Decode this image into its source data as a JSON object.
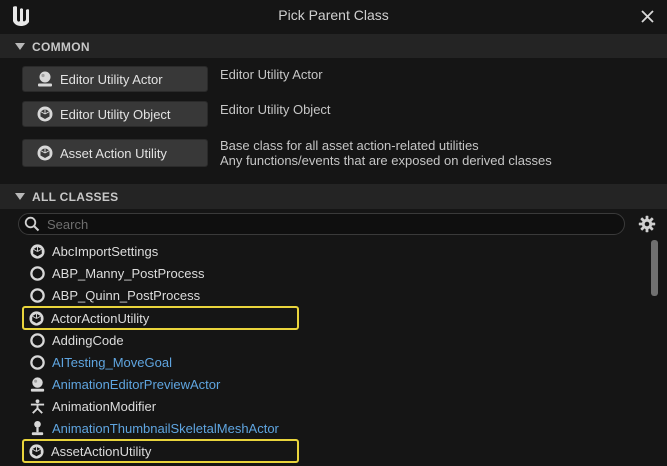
{
  "window": {
    "title": "Pick Parent Class"
  },
  "common": {
    "header": "COMMON",
    "buttons": [
      {
        "label": "Editor Utility Actor",
        "icon": "actor-icon",
        "desc1": "Editor Utility Actor",
        "desc2": ""
      },
      {
        "label": "Editor Utility Object",
        "icon": "object-icon",
        "desc1": "Editor Utility Object",
        "desc2": ""
      },
      {
        "label": "Asset Action Utility",
        "icon": "object-icon",
        "desc1": "Base class for all asset action-related utilities",
        "desc2": "Any functions/events that are exposed on derived classes"
      }
    ]
  },
  "all_classes": {
    "header": "ALL CLASSES",
    "search_placeholder": "Search",
    "items": [
      {
        "label": "AbcImportSettings",
        "icon": "object-icon",
        "style": "normal",
        "highlighted": false
      },
      {
        "label": "ABP_Manny_PostProcess",
        "icon": "circle-icon",
        "style": "normal",
        "highlighted": false
      },
      {
        "label": "ABP_Quinn_PostProcess",
        "icon": "circle-icon",
        "style": "normal",
        "highlighted": false
      },
      {
        "label": "ActorActionUtility",
        "icon": "object-icon",
        "style": "normal",
        "highlighted": true
      },
      {
        "label": "AddingCode",
        "icon": "circle-icon",
        "style": "normal",
        "highlighted": false
      },
      {
        "label": "AITesting_MoveGoal",
        "icon": "circle-icon",
        "style": "blue",
        "highlighted": false
      },
      {
        "label": "AnimationEditorPreviewActor",
        "icon": "actor-icon",
        "style": "blue",
        "highlighted": false
      },
      {
        "label": "AnimationModifier",
        "icon": "modifier-icon",
        "style": "normal",
        "highlighted": false
      },
      {
        "label": "AnimationThumbnailSkeletalMeshActor",
        "icon": "skeletal-icon",
        "style": "blue",
        "highlighted": false
      },
      {
        "label": "AssetActionUtility",
        "icon": "object-icon",
        "style": "normal",
        "highlighted": true
      }
    ]
  },
  "colors": {
    "highlight": "#e9d43c",
    "blue_text": "#5fa5e0",
    "background": "#151515",
    "header": "#242424"
  }
}
